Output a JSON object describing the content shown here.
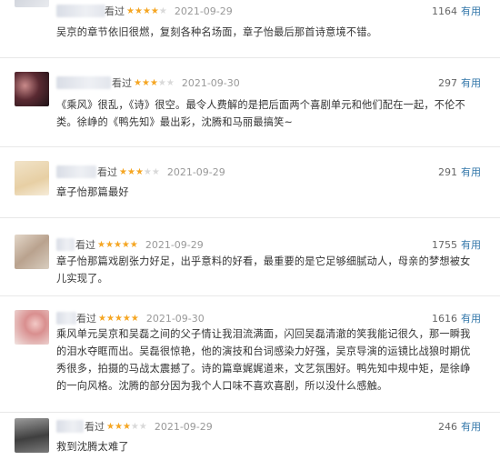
{
  "labels": {
    "watched": "看过",
    "useful": "有用"
  },
  "colors": {
    "star_on": "#f5a623",
    "star_off": "#d9d9d9",
    "useful_link": "#3377aa"
  },
  "reviews": [
    {
      "rating": 4,
      "date": "2021-09-29",
      "votes": "1164",
      "text": "吴京的章节依旧很燃，复刻各种名场面，章子怡最后那首诗意境不错。"
    },
    {
      "rating": 3,
      "date": "2021-09-30",
      "votes": "297",
      "text": "《乘风》很乱，《诗》很空。最令人费解的是把后面两个喜剧单元和他们配在一起，不伦不类。徐峥的《鸭先知》最出彩，沈腾和马丽最搞笑~"
    },
    {
      "rating": 3,
      "date": "2021-09-29",
      "votes": "291",
      "text": "章子怡那篇最好"
    },
    {
      "rating": 5,
      "date": "2021-09-29",
      "votes": "1755",
      "text": "章子怡那篇戏剧张力好足，出乎意料的好看，最重要的是它足够细腻动人，母亲的梦想被女儿实现了。"
    },
    {
      "rating": 5,
      "date": "2021-09-30",
      "votes": "1616",
      "text": "乘风单元吴京和吴磊之间的父子情让我泪流满面，闪回吴磊清澈的笑我能记很久，那一瞬我的泪水夺眶而出。吴磊很惊艳，他的演技和台词感染力好强，吴京导演的运镜比战狼时期优秀很多，拍摄的马战太震撼了。诗的篇章娓娓道来，文艺氛围好。鸭先知中规中矩，是徐峥的一向风格。沈腾的部分因为我个人口味不喜欢喜剧，所以没什么感触。"
    },
    {
      "rating": 3,
      "date": "2021-09-29",
      "votes": "246",
      "text": "救到沈腾太难了"
    }
  ]
}
